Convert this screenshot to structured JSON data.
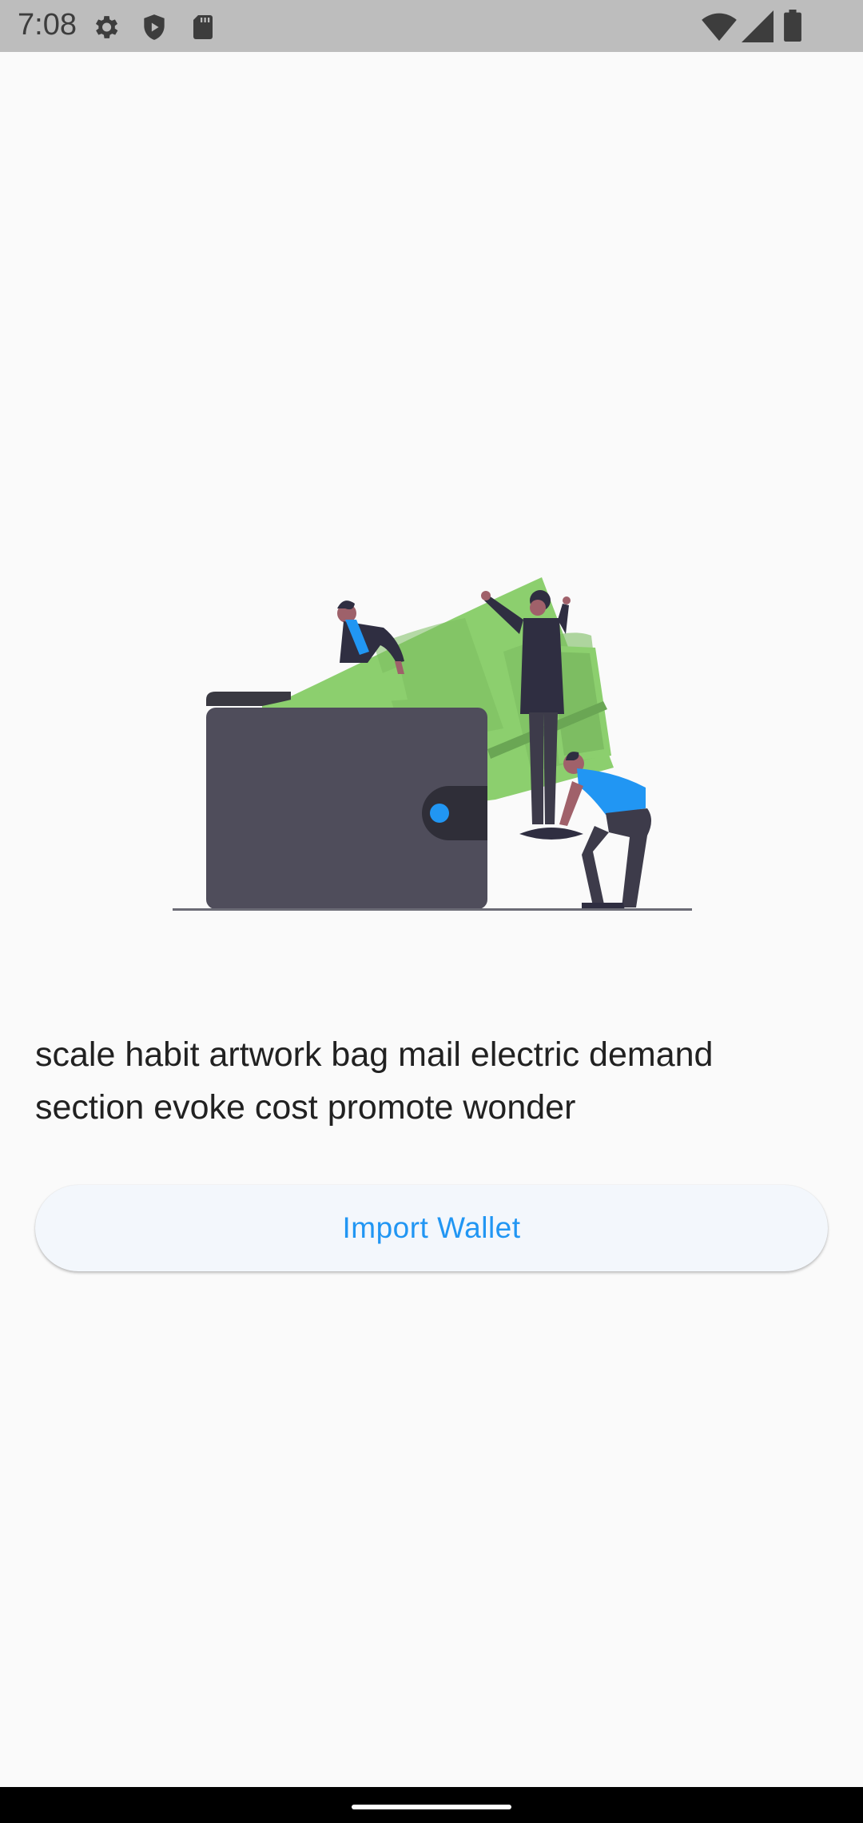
{
  "status_bar": {
    "time": "7:08",
    "left_icons": [
      "gear-icon",
      "shield-icon",
      "sd-card-icon"
    ],
    "right_icons": [
      "wifi-icon",
      "cell-signal-icon",
      "battery-icon"
    ]
  },
  "illustration": {
    "name": "wallet-money-illustration",
    "colors": {
      "wallet": "#4f4d5b",
      "wallet_dark": "#3a3942",
      "money": "#8ccf6e",
      "money_dark": "#6aa654",
      "accent_blue": "#2196f3",
      "suit": "#2f2e41"
    }
  },
  "main": {
    "phrase": "scale habit artwork bag mail electric demand section evoke cost promote wonder",
    "import_button_label": "Import Wallet"
  },
  "colors": {
    "accent": "#2196f3",
    "background": "#fafafa",
    "button_bg": "#f3f7fc"
  }
}
